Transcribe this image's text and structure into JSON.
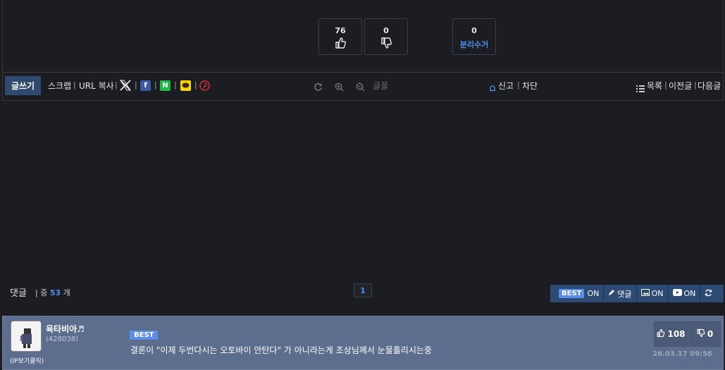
{
  "votes": {
    "up_count": "76",
    "down_count": "0",
    "recycle_count": "0",
    "recycle_label": "분리수거"
  },
  "toolbar": {
    "write_label": "글쓰기",
    "scrap_label": "스크랩",
    "url_copy_label": "URL 복사",
    "font_label": "글꼴",
    "report_label": "신고",
    "block_label": "차단",
    "list_label": "목록",
    "prev_label": "이전글",
    "next_label": "다음글",
    "separator": "|",
    "facebook_glyph": "f",
    "naver_glyph": "N"
  },
  "comments": {
    "title": "댓글",
    "count_prefix": "| 중",
    "count": "53",
    "count_suffix": "개",
    "page": "1",
    "options": {
      "best_label": "BEST",
      "best_state": "ON",
      "reply_label": "댓글",
      "image_state": "ON",
      "video_state": "ON"
    },
    "items": [
      {
        "nickname": "육타비아♬",
        "user_id": "(428038)",
        "ip_label": "(IP보기클릭)",
        "badge": "BEST",
        "text": "결론이 \"이제 두번다시는 오토바이 안탄다\" 가 아니라는게 조상님께서 눈물흘리시는중",
        "likes": "108",
        "dislikes": "0",
        "date": "26.03.17 09:56"
      }
    ]
  },
  "colors": {
    "background": "#1b1d22",
    "accent": "#4d8fe6",
    "write_button": "#2f4a6e",
    "option_bar": "#2c4a73",
    "best_row": "#5c6d8d"
  }
}
